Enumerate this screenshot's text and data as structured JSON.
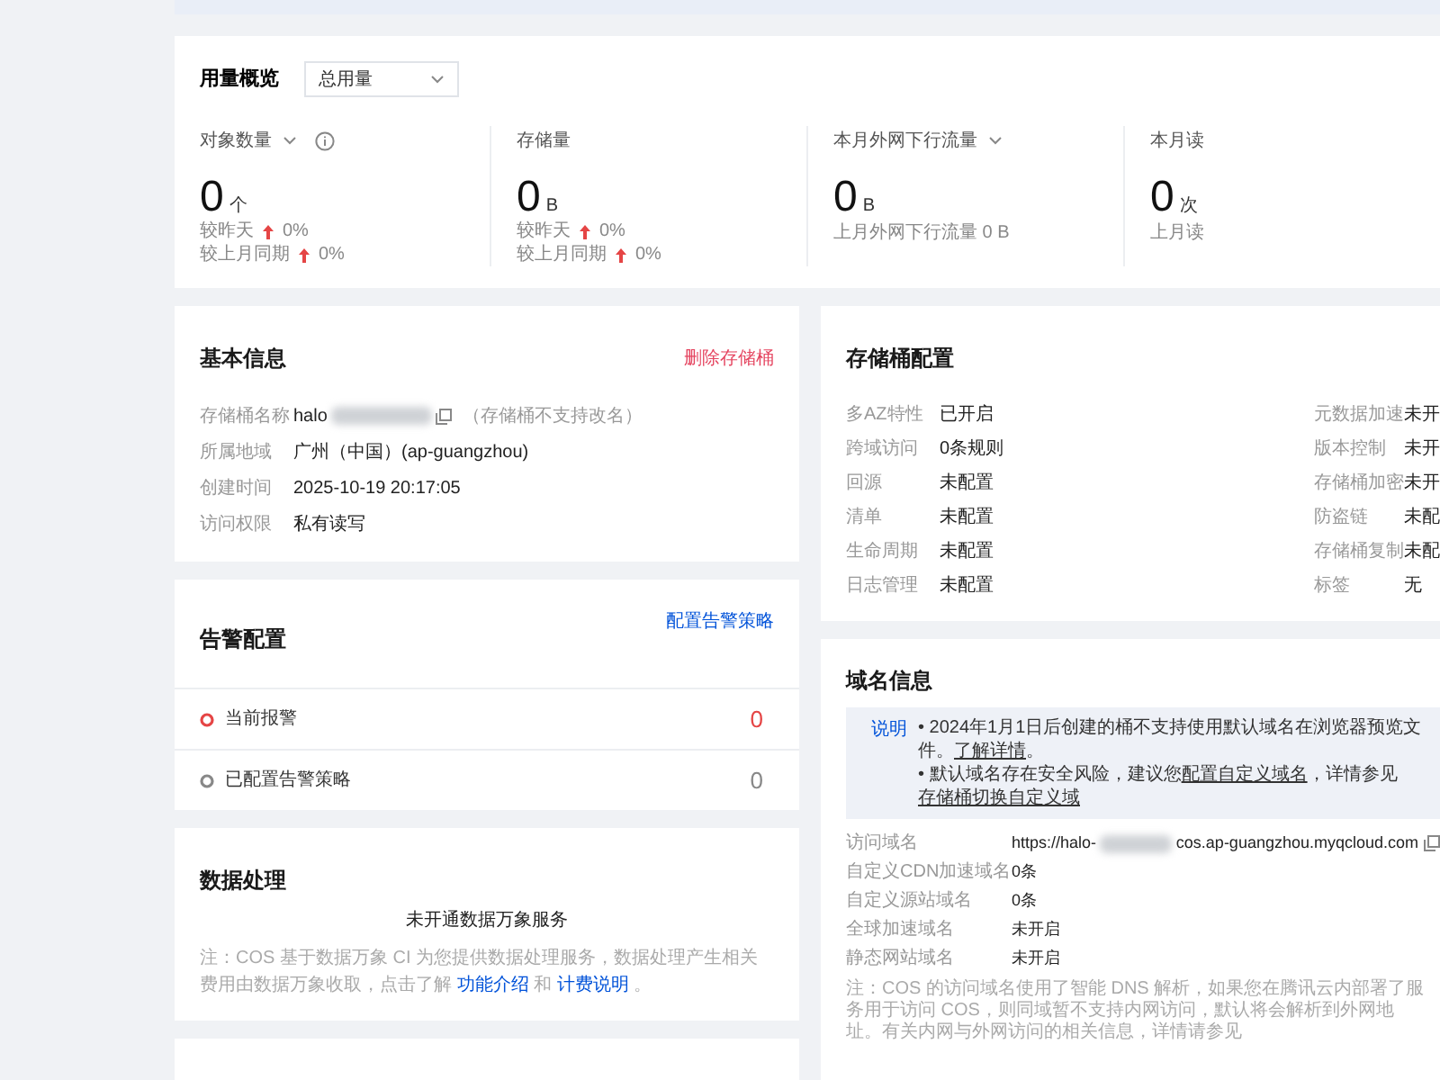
{
  "overview": {
    "title": "用量概览",
    "scope_select": "总用量",
    "metrics": [
      {
        "label": "对象数量",
        "dropdown": true,
        "info": true,
        "value": "0",
        "unit": "个",
        "kind": "compare",
        "comparisons": [
          {
            "label": "较昨天",
            "change": "0%"
          },
          {
            "label": "较上月同期",
            "change": "0%"
          }
        ]
      },
      {
        "label": "存储量",
        "dropdown": false,
        "info": false,
        "value": "0",
        "unit": "B",
        "kind": "compare",
        "comparisons": [
          {
            "label": "较昨天",
            "change": "0%"
          },
          {
            "label": "较上月同期",
            "change": "0%"
          }
        ]
      },
      {
        "label": "本月外网下行流量",
        "dropdown": true,
        "info": false,
        "value": "0",
        "unit": "B",
        "kind": "note",
        "note": "上月外网下行流量 0 B"
      },
      {
        "label": "本月读",
        "dropdown": false,
        "info": false,
        "value": "0",
        "unit": "次",
        "kind": "note",
        "note": "上月读"
      }
    ]
  },
  "basic_info": {
    "title": "基本信息",
    "action": "删除存储桶",
    "fields": [
      {
        "label": "存储桶名称",
        "value": "halo",
        "redacted": true,
        "copy": true,
        "note": "（存储桶不支持改名）"
      },
      {
        "label": "所属地域",
        "value": "广州（中国）(ap-guangzhou)",
        "redacted": false,
        "copy": false
      },
      {
        "label": "创建时间",
        "value": "2025-10-19 20:17:05",
        "redacted": false,
        "copy": false
      },
      {
        "label": "访问权限",
        "value": "私有读写",
        "redacted": false,
        "copy": false
      }
    ]
  },
  "alarm": {
    "title": "告警配置",
    "action": "配置告警策略",
    "rows": [
      {
        "label": "当前报警",
        "count": "0",
        "color": "#e54545"
      },
      {
        "label": "已配置告警策略",
        "count": "0",
        "color": "#888888"
      }
    ]
  },
  "data_processing": {
    "title": "数据处理",
    "status": "未开通数据万象服务",
    "note_before": "注：COS 基于数据万象 CI 为您提供数据处理服务，数据处理产生相关费用由数据万象收取，点击了解",
    "link_1": "功能介绍",
    "note_middle": "和",
    "link_2": "计费说明",
    "note_after": "。"
  },
  "bucket_config": {
    "title": "存储桶配置",
    "columns": [
      [
        {
          "label": "多AZ特性",
          "value": "已开启"
        },
        {
          "label": "跨域访问",
          "value": "0条规则"
        },
        {
          "label": "回源",
          "value": "未配置"
        },
        {
          "label": "清单",
          "value": "未配置"
        },
        {
          "label": "生命周期",
          "value": "未配置"
        },
        {
          "label": "日志管理",
          "value": "未配置"
        }
      ],
      [
        {
          "label": "元数据加速",
          "value": "未开"
        },
        {
          "label": "版本控制",
          "value": "未开"
        },
        {
          "label": "存储桶加密",
          "value": "未开"
        },
        {
          "label": "防盗链",
          "value": "未配"
        },
        {
          "label": "存储桶复制",
          "value": "未配"
        },
        {
          "label": "标签",
          "value": "无"
        }
      ]
    ]
  },
  "domain_info": {
    "title": "域名信息",
    "notice": {
      "tag": "说明",
      "items": [
        {
          "bullet": "•",
          "text": "2024年1月1日后创建的桶不支持使用默认域名在浏览器预览文件。",
          "link": "了解详情",
          "after": "。"
        },
        {
          "bullet": "•",
          "text": "默认域名存在安全风险，建议您",
          "link": "配置自定义域名",
          "after": "，详情参见",
          "link_2": "存储桶切换自定义域"
        }
      ]
    },
    "fields": [
      {
        "label": "访问域名",
        "value_before": "https://halo-",
        "redacted": true,
        "value_after": "cos.ap-guangzhou.myqcloud.com",
        "copy": true
      },
      {
        "label": "自定义CDN加速域名",
        "value_before": "0条",
        "redacted": false,
        "copy": false
      },
      {
        "label": "自定义源站域名",
        "value_before": "0条",
        "redacted": false,
        "copy": false
      },
      {
        "label": "全球加速域名",
        "value_before": "未开启",
        "redacted": false,
        "copy": false
      },
      {
        "label": "静态网站域名",
        "value_before": "未开启",
        "redacted": false,
        "copy": false
      }
    ],
    "note": "注：COS 的访问域名使用了智能 DNS 解析，如果您在腾讯云内部署了服务用于访问 COS，则同域暂不支持内网访问，默认将会解析到外网地址。有关内网与外网访问的相关信息，详情请参见"
  }
}
